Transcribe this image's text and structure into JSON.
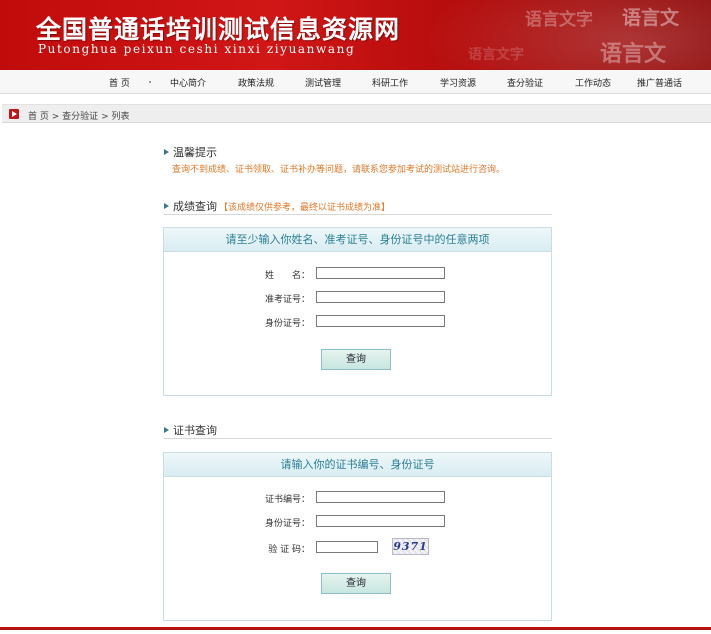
{
  "header": {
    "title": "全国普通话培训测试信息资源网",
    "subtitle": "Putonghua peixun ceshi xinxi ziyuanwang",
    "deco_words": [
      "语言文字",
      "语言文",
      "语言文",
      "语言文字"
    ]
  },
  "nav": {
    "items": [
      {
        "label": "首  页"
      },
      {
        "label": "中心简介"
      },
      {
        "label": "政策法规"
      },
      {
        "label": "测试管理"
      },
      {
        "label": "科研工作"
      },
      {
        "label": "学习资源"
      },
      {
        "label": "查分验证"
      },
      {
        "label": "工作动态"
      },
      {
        "label": "推广普通话"
      }
    ]
  },
  "breadcrumb": {
    "home": "首 页",
    "sep1": ">",
    "section": "查分验证",
    "sep2": ">",
    "current": "列表"
  },
  "tips": {
    "heading": "温馨提示",
    "text": "查询不到成绩、证书领取、证书补办等问题，请联系您参加考试的测试站进行咨询。"
  },
  "score_query": {
    "heading": "成绩查询",
    "note": "【该成绩仅供参考，最终以证书成绩为准】",
    "box_title": "请至少输入你姓名、准考证号、身份证号中的任意两项",
    "fields": [
      {
        "label": "姓　　名：",
        "value": ""
      },
      {
        "label": "准考证号：",
        "value": ""
      },
      {
        "label": "身份证号：",
        "value": ""
      }
    ],
    "submit_label": "查询"
  },
  "cert_query": {
    "heading": "证书查询",
    "box_title": "请输入你的证书编号、身份证号",
    "fields": [
      {
        "label": "证书编号：",
        "value": ""
      },
      {
        "label": "身份证号：",
        "value": ""
      },
      {
        "label": "验 证 码：",
        "value": ""
      }
    ],
    "captcha": "9371",
    "submit_label": "查询"
  },
  "colors": {
    "banner_red": "#c10b0b",
    "accent_teal": "#2b7f95",
    "tip_orange": "#e0782a"
  }
}
